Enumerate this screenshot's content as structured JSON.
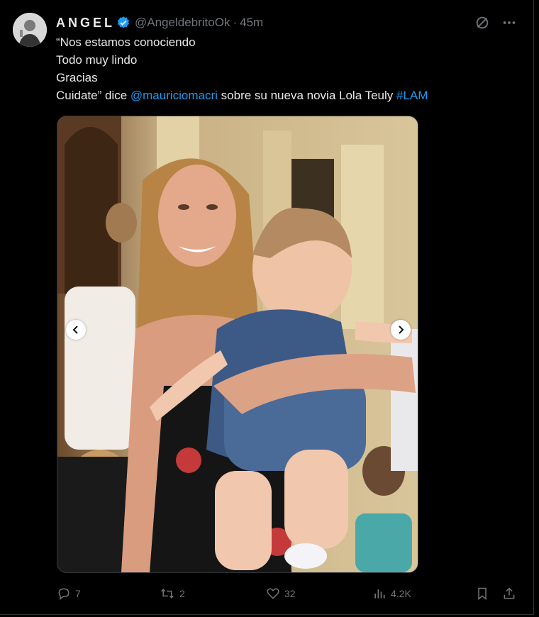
{
  "tweet": {
    "author_name": "ANGEL",
    "handle": "@AngeldebritoOk",
    "separator": "·",
    "time": "45m",
    "text_lines": [
      "“Nos estamos conociendo",
      "Todo muy lindo",
      "Gracias"
    ],
    "last_line": {
      "prefix": "Cuidate” dice ",
      "mention": "@mauriciomacri",
      "middle": " sobre su nueva novia Lola Teuly ",
      "hashtag": "#LAM"
    }
  },
  "actions": {
    "replies": "7",
    "reposts": "2",
    "likes": "32",
    "views": "4.2K"
  },
  "colors": {
    "background": "#000000",
    "text": "#e7e9ea",
    "secondary": "#71767b",
    "link": "#1d9bf0",
    "verified": "#1d9bf0"
  },
  "icons": [
    "grok-icon",
    "more-icon",
    "verified-icon",
    "reply-icon",
    "repost-icon",
    "like-icon",
    "views-icon",
    "bookmark-icon",
    "share-icon",
    "chevron-left-icon",
    "chevron-right-icon"
  ]
}
